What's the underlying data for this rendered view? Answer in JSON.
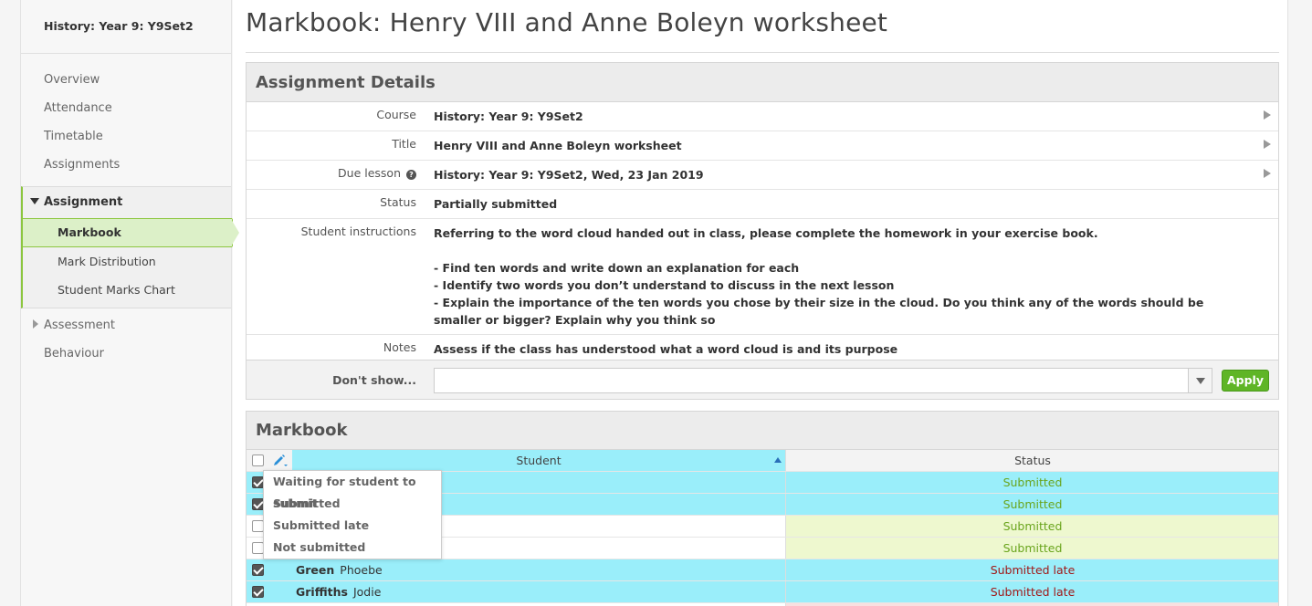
{
  "sidebar": {
    "title": "History: Year 9: Y9Set2",
    "items": [
      "Overview",
      "Attendance",
      "Timetable",
      "Assignments"
    ],
    "group": {
      "label": "Assignment",
      "subitems": [
        "Markbook",
        "Mark Distribution",
        "Student Marks Chart"
      ]
    },
    "after": {
      "assessment": "Assessment",
      "behaviour": "Behaviour"
    }
  },
  "page": {
    "title": "Markbook: Henry VIII and Anne Boleyn worksheet"
  },
  "details": {
    "heading": "Assignment Details",
    "course_label": "Course",
    "course_value": "History: Year 9: Y9Set2",
    "title_label": "Title",
    "title_value": "Henry VIII and Anne Boleyn worksheet",
    "due_label": "Due lesson",
    "due_value": "History: Year 9: Y9Set2, Wed, 23 Jan 2019",
    "status_label": "Status",
    "status_value": "Partially submitted",
    "instructions_label": "Student instructions",
    "instructions": [
      "Referring to the word cloud handed out in class, please complete the homework in your exercise book.",
      "",
      "- Find ten words and write down an explanation for each",
      "- Identify two words you don’t understand to discuss in the next lesson",
      "- Explain the importance of the ten words you chose by their size in the cloud. Do you think any of the words should be smaller or bigger? Explain why you think so"
    ],
    "notes_label": "Notes",
    "notes_value": "Assess if the class has understood what a word cloud is and its purpose"
  },
  "filter": {
    "label": "Don't show...",
    "apply": "Apply"
  },
  "markbook": {
    "heading": "Markbook",
    "col_student": "Student",
    "col_status": "Status",
    "rows": [
      {
        "last": "",
        "first": "",
        "status": "Submitted",
        "checked": true
      },
      {
        "last": "",
        "first": "",
        "status": "Submitted",
        "checked": true
      },
      {
        "last": "",
        "first": "",
        "status": "Submitted",
        "checked": false
      },
      {
        "last": "",
        "first": "",
        "status": "Submitted",
        "checked": false
      },
      {
        "last": "Green",
        "first": "Phoebe",
        "status": "Submitted late",
        "checked": true
      },
      {
        "last": "Griffiths",
        "first": "Jodie",
        "status": "Submitted late",
        "checked": true
      }
    ]
  },
  "popup": {
    "options": [
      "Waiting for student to submit",
      "Submitted",
      "Submitted late",
      "Not submitted"
    ]
  },
  "colors": {
    "accent_green": "#8cc63f",
    "selected_row": "#9aeefa",
    "submitted_bg": "#eef8cf",
    "submitted_text": "#6aa51d",
    "late_text": "#a01818",
    "apply_button": "#5fb526"
  }
}
